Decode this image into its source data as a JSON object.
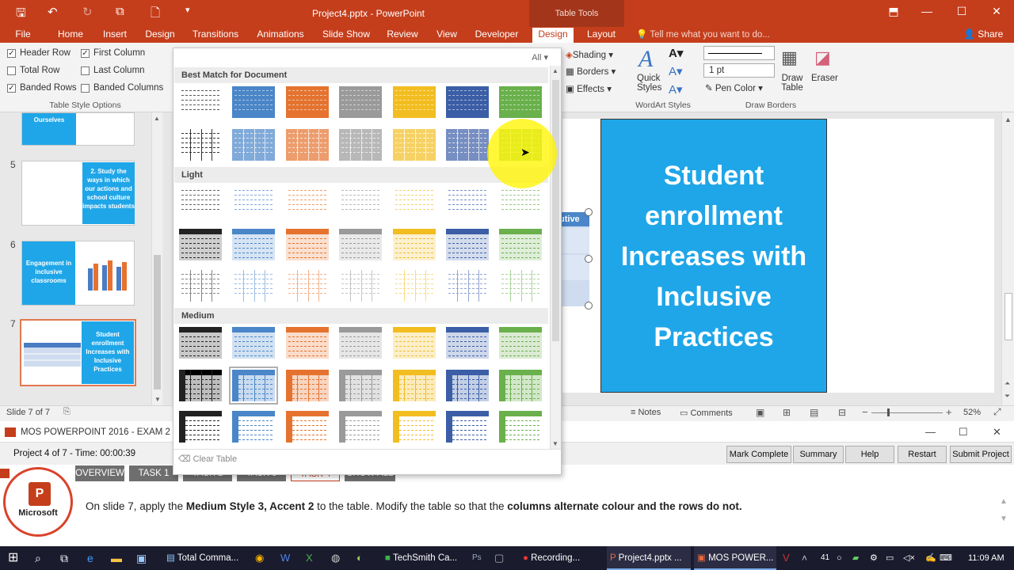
{
  "window": {
    "title": "Project4.pptx - PowerPoint",
    "context_tab_group": "Table Tools",
    "share_label": "Share",
    "tell_me_placeholder": "Tell me what you want to do..."
  },
  "ribbon_tabs": [
    "File",
    "Home",
    "Insert",
    "Design",
    "Transitions",
    "Animations",
    "Slide Show",
    "Review",
    "View",
    "Developer",
    "Design",
    "Layout"
  ],
  "table_style_options": {
    "group_label": "Table Style Options",
    "items": [
      {
        "label": "Header Row",
        "checked": true
      },
      {
        "label": "First Column",
        "checked": true
      },
      {
        "label": "Total Row",
        "checked": false
      },
      {
        "label": "Last Column",
        "checked": false
      },
      {
        "label": "Banded Rows",
        "checked": true
      },
      {
        "label": "Banded Columns",
        "checked": false
      }
    ]
  },
  "ribbon_right": {
    "shading": "Shading",
    "borders": "Borders",
    "effects": "Effects",
    "quick_styles_1": "Quick",
    "quick_styles_2": "Styles",
    "wordart_label": "WordArt Styles",
    "pen_weight": "1 pt",
    "pen_color": "Pen Color",
    "draw_table_1": "Draw",
    "draw_table_2": "Table",
    "eraser": "Eraser",
    "draw_borders_label": "Draw Borders"
  },
  "gallery": {
    "filter": "All",
    "sections": [
      "Best Match for Document",
      "Light",
      "Medium"
    ],
    "clear_table": "Clear Table"
  },
  "thumbnails": [
    {
      "num": "",
      "text": "Ourselves"
    },
    {
      "num": "5",
      "text": "2. Study the ways in which our actions and school culture impacts students"
    },
    {
      "num": "6",
      "text": "Engagement in inclusive classrooms"
    },
    {
      "num": "7",
      "text": "Student enrollment Increases with Inclusive Practices"
    }
  ],
  "slide": {
    "main_text": "Student enrollment Increases with Inclusive Practices",
    "table_fragment": "utive"
  },
  "status": {
    "slide": "Slide 7 of 7",
    "notes": "Notes",
    "comments": "Comments",
    "zoom": "52%"
  },
  "exam": {
    "window_title": "MOS POWERPOINT 2016 - EXAM 2 - (C",
    "progress": "Project 4 of 7 - Time: 00:00:39",
    "buttons": [
      "Mark Complete",
      "Summary",
      "Help",
      "Restart",
      "Submit Project"
    ],
    "tabs": [
      "OVERVIEW",
      "TASK 1",
      "TASK 2",
      "TASK 3",
      "TASK 4",
      "SHOW ALL"
    ],
    "logo_text": "Microsoft",
    "instruction_1": "On slide 7, apply the ",
    "instruction_b1": "Medium Style 3, Accent 2",
    "instruction_2": " to the table. Modify the table so that the ",
    "instruction_b2": "columns alternate colour and the rows do not."
  },
  "taskbar": {
    "items": [
      "Total Comma...",
      "TechSmith Ca...",
      "Recording...",
      "Project4.pptx ...",
      "MOS POWER..."
    ],
    "badge": "41",
    "time": "11:09 AM"
  },
  "colors": {
    "accent": "#c43e1c",
    "slide_blue": "#1fa6e8",
    "style_colors": [
      "#222222",
      "#4a86c8",
      "#e5732f",
      "#9a9a9a",
      "#f2bd21",
      "#3b5ea7",
      "#6ab04c"
    ]
  }
}
